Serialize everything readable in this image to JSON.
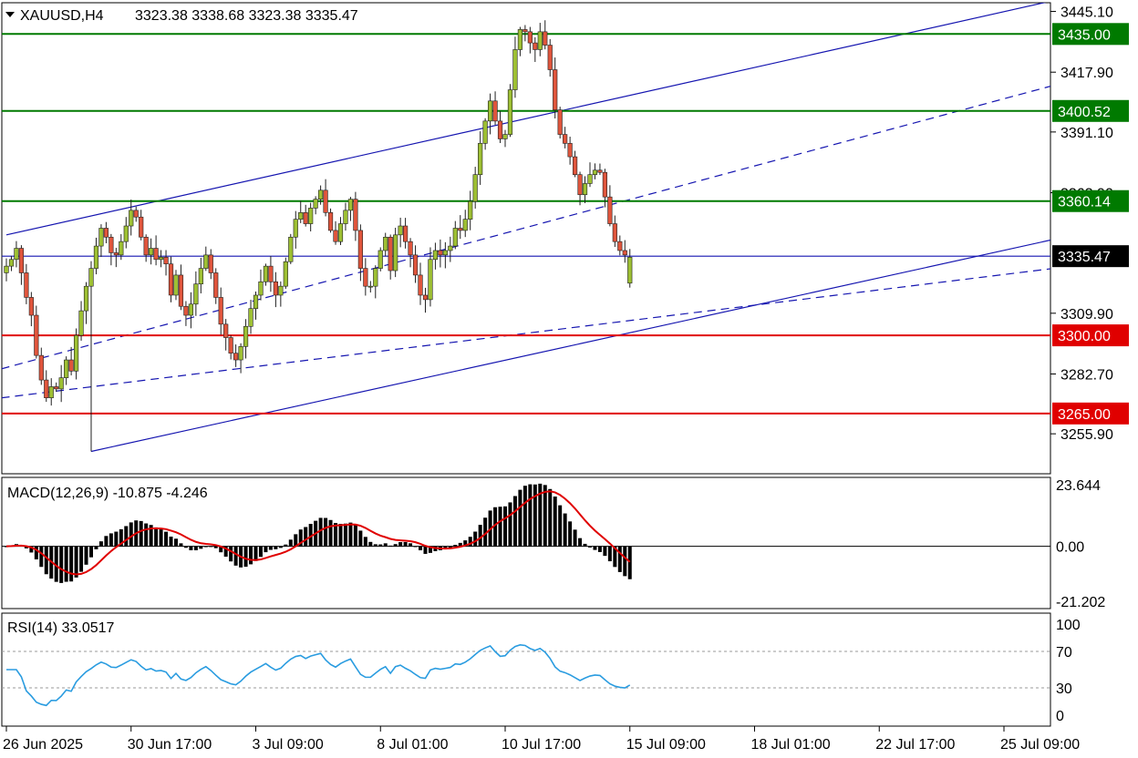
{
  "header": {
    "symbol": "XAUUSD,H4",
    "ohlc": "3323.38 3338.68 3323.38 3335.47",
    "menu_icon": "triangle-down-icon"
  },
  "price_axis": {
    "ticks": [
      "3445.10",
      "3417.90",
      "3391.10",
      "3363.90",
      "3309.90",
      "3282.70",
      "3255.90"
    ],
    "tick_values": [
      3445.1,
      3417.9,
      3391.1,
      3363.9,
      3309.9,
      3282.7,
      3255.9
    ],
    "range": [
      3238,
      3449
    ]
  },
  "levels": [
    {
      "label": "3435.00",
      "value": 3435.0,
      "color": "#007a00"
    },
    {
      "label": "3400.52",
      "value": 3400.52,
      "color": "#007a00"
    },
    {
      "label": "3360.14",
      "value": 3360.14,
      "color": "#007a00"
    },
    {
      "label": "3335.47",
      "value": 3335.47,
      "color": "#1515b0"
    },
    {
      "label": "3300.00",
      "value": 3300.0,
      "color": "#e00000"
    },
    {
      "label": "3265.00",
      "value": 3265.0,
      "color": "#e00000"
    }
  ],
  "time_axis": {
    "labels": [
      "26 Jun 2025",
      "30 Jun 17:00",
      "3 Jul 09:00",
      "8 Jul 01:00",
      "10 Jul 17:00",
      "15 Jul 09:00",
      "18 Jul 01:00",
      "22 Jul 17:00",
      "25 Jul 09:00"
    ],
    "label_bars": [
      0,
      25,
      50,
      75,
      100,
      125,
      150,
      175,
      200
    ]
  },
  "macd": {
    "title": "MACD(12,26,9) -10.875 -4.246",
    "ticks": [
      "23.644",
      "0.00",
      "-21.202"
    ],
    "tick_values": [
      23.644,
      0,
      -21.202
    ]
  },
  "rsi": {
    "title": "RSI(14) 33.0517",
    "ticks": [
      "100",
      "70",
      "30",
      "0"
    ],
    "tick_values": [
      100,
      70,
      30,
      0
    ]
  },
  "colors": {
    "bull": "#9ec033",
    "bear": "#e0553c",
    "candle_outline": "#202020",
    "channel": "#1515b0",
    "macd_hist": "#000000",
    "macd_signal": "#e00000",
    "rsi_line": "#2a9ce0"
  },
  "chart_data": [
    {
      "type": "candlestick",
      "title": "XAUUSD,H4",
      "timeframe": "H4",
      "x_start": "26 Jun 2025",
      "close_series": [
        3331,
        3334,
        3339,
        3328,
        3317,
        3309,
        3291,
        3280,
        3272,
        3277,
        3276,
        3281,
        3289,
        3284,
        3300,
        3311,
        3322,
        3330,
        3340,
        3348,
        3344,
        3337,
        3336,
        3342,
        3349,
        3356,
        3353,
        3344,
        3336,
        3339,
        3334,
        3335,
        3332,
        3318,
        3327,
        3313,
        3309,
        3314,
        3323,
        3330,
        3336,
        3328,
        3317,
        3305,
        3299,
        3292,
        3289,
        3295,
        3304,
        3312,
        3318,
        3324,
        3331,
        3324,
        3318,
        3322,
        3333,
        3344,
        3352,
        3355,
        3350,
        3357,
        3361,
        3365,
        3355,
        3347,
        3342,
        3350,
        3356,
        3361,
        3347,
        3330,
        3322,
        3322,
        3330,
        3338,
        3344,
        3329,
        3345,
        3349,
        3342,
        3336,
        3327,
        3318,
        3316,
        3334,
        3338,
        3336,
        3338,
        3340,
        3348,
        3347,
        3352,
        3360,
        3372,
        3386,
        3396,
        3405,
        3396,
        3388,
        3390,
        3410,
        3428,
        3437,
        3436,
        3431,
        3428,
        3436,
        3430,
        3419,
        3401,
        3390,
        3386,
        3380,
        3372,
        3363,
        3368,
        3372,
        3374,
        3373,
        3362,
        3350,
        3342,
        3338,
        3336,
        3335
      ],
      "period_summary": {
        "high": 3439,
        "low": 3248,
        "last_close": 3335.47,
        "last_bar_open": 3323.38,
        "last_bar_high": 3338.68,
        "last_bar_low": 3323.38
      },
      "levels": [
        3435.0,
        3400.52,
        3360.14,
        3335.47,
        3300.0,
        3265.0
      ],
      "ylim": [
        3238,
        3449
      ],
      "grid": false,
      "legend": "none"
    },
    {
      "type": "bar",
      "title": "MACD(12,26,9) -10.875 -4.246",
      "main": -10.875,
      "signal": -4.246,
      "ylim": [
        -24,
        26.5
      ]
    },
    {
      "type": "line",
      "title": "RSI(14) 33.0517",
      "value": 33.0517,
      "levels": [
        70,
        30
      ],
      "ylim": [
        0,
        100
      ]
    }
  ]
}
